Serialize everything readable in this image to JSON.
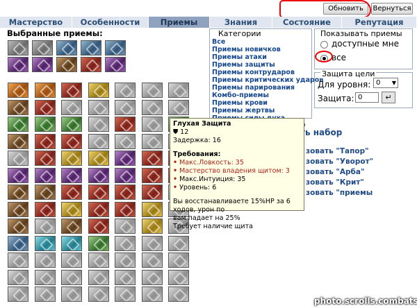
{
  "buttons": {
    "refresh": "Обновить",
    "back": "Вернуться"
  },
  "tabs": [
    {
      "label": "Мастерство",
      "active": false
    },
    {
      "label": "Особенности",
      "active": false
    },
    {
      "label": "Приемы",
      "active": true
    },
    {
      "label": "Знания",
      "active": false
    },
    {
      "label": "Состояние",
      "active": false
    },
    {
      "label": "Репутация",
      "active": false
    }
  ],
  "chosen_title": "Выбранные приемы:",
  "categories": {
    "title": "Категории",
    "items": [
      "Все",
      "Приемы новичков",
      "Приемы атаки",
      "Приемы защиты",
      "Приемы контрудаpов",
      "Приемы критических ударов",
      "Приемы парирования",
      "Комбо-приемы",
      "Приемы крови",
      "Приемы жертвы",
      "Приемы силы духа"
    ]
  },
  "show": {
    "title": "Показывать приемы",
    "opt_available": "доступные мне",
    "opt_all": "все",
    "selected": "все"
  },
  "protection": {
    "title": "Защита цели",
    "level_label": "Для уровня:",
    "level_value": "0",
    "prot_label": "Защита:",
    "prot_value": "0"
  },
  "sets": {
    "partial_top": "р",
    "save_set": "ть набор",
    "items": [
      "зовать \"Тапор\"",
      "зовать \"Уворот\"",
      "зовать \"Арба\"",
      "зовать \"Крит\"",
      "зовать \"приемы"
    ]
  },
  "tooltip": {
    "title": "Глухая Защита",
    "cost": "12",
    "delay": "Задержка: 16",
    "req_title": "Требования:",
    "req1": "Макс.Ловкость: 35",
    "req2": "Мастерство владения щитом: 3",
    "req3": "Макс.Интуиция: 35",
    "req4": "Уровень: 6",
    "desc1": "Вы восстанавливаете 15%HP за 6 ходов, урон по",
    "desc2": "вам падает на 25%",
    "desc3": "Требует наличие щита"
  },
  "watermark": "photo.scrolls.combats.com",
  "icon_colors": {
    "selected_row1": [
      "gdark",
      "gdark",
      "blue",
      "blue",
      "blue"
    ],
    "selected_row2": [
      "purple",
      "purple",
      "brown",
      "red",
      "purple"
    ],
    "grid": [
      [
        "orange",
        "orange",
        "red",
        "yellow",
        "gray",
        "gray",
        "gray"
      ],
      [
        "brown",
        "red",
        "gray",
        "gray",
        "gray",
        "gray",
        "gray"
      ],
      [
        "green",
        "green",
        "green",
        "gray",
        "red",
        "gray",
        "green"
      ],
      [
        "brown",
        "red",
        "red",
        "gray",
        "gray",
        "gray",
        "gray"
      ],
      [
        "gray",
        "red",
        "yellow",
        "yellow",
        "purple",
        "red",
        "red"
      ],
      [
        "purple",
        "purple",
        "purple",
        "purple",
        "purple",
        "red",
        "red"
      ],
      [
        "brown",
        "brown",
        "red",
        "red",
        "red",
        "red",
        "gray"
      ],
      [
        "brown",
        "red",
        "yellow",
        "red",
        "red",
        "yellow",
        "gray"
      ],
      [
        "brown",
        "gray",
        "brown",
        "red",
        "gray",
        "yellow",
        "gray"
      ],
      [
        "blue",
        "cyan",
        "cyan",
        "green",
        "gray",
        "gray",
        "gray"
      ],
      [
        "gray",
        "gray",
        "gray",
        "gray",
        "gray",
        "gray",
        "gray"
      ],
      [
        "gray",
        "gray",
        "gray",
        "gray",
        "gray",
        "gray",
        "gray"
      ],
      [
        "gray",
        "gray",
        "gray",
        "gray",
        "gray",
        "gray",
        "gray"
      ],
      [
        "gray",
        "gray",
        "gray",
        "gray",
        "gray",
        "gray",
        "gray"
      ]
    ]
  }
}
